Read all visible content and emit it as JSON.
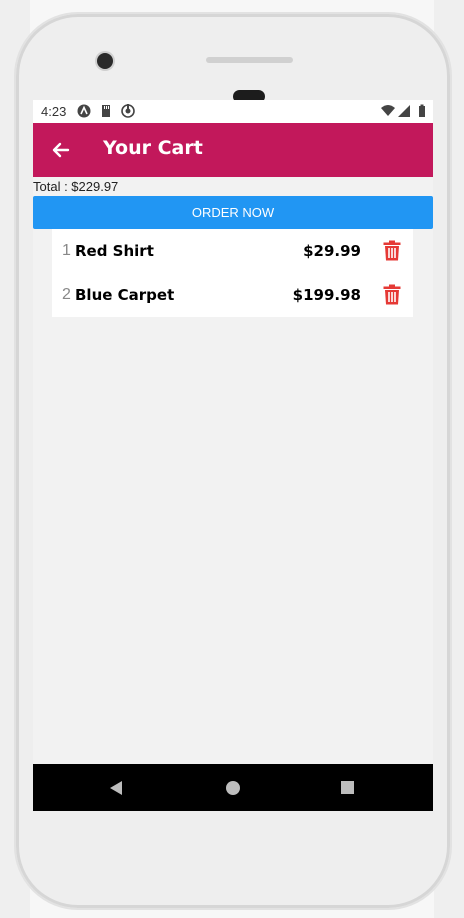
{
  "status_bar": {
    "time": "4:23",
    "left_icons": [
      "app-a-icon",
      "sd-card-icon",
      "sync-icon"
    ],
    "right_icons": [
      "wifi-icon",
      "signal-icon",
      "battery-icon"
    ]
  },
  "app_bar": {
    "back_icon": "arrow-left-icon",
    "title": "Your Cart",
    "color": "#c2185b"
  },
  "cart": {
    "total_label": "Total : $229.97",
    "order_button_label": "ORDER NOW",
    "order_button_color": "#2196f3",
    "items": [
      {
        "index": "1",
        "name": "Red Shirt",
        "price": "$29.99",
        "delete_icon": "trash-icon"
      },
      {
        "index": "2",
        "name": "Blue Carpet",
        "price": "$199.98",
        "delete_icon": "trash-icon"
      }
    ],
    "delete_color": "#e53935"
  },
  "nav_bar": {
    "buttons": [
      "back-triangle-icon",
      "home-circle-icon",
      "recents-square-icon"
    ]
  }
}
